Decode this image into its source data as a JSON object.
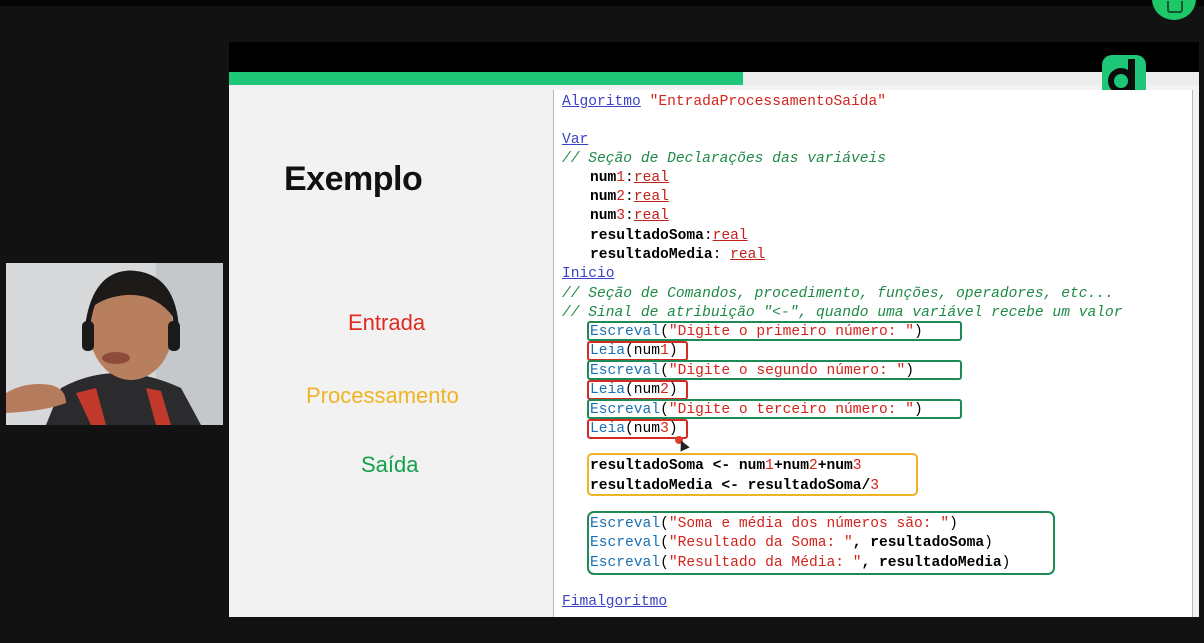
{
  "slide": {
    "progress_fraction": 0.53,
    "title": "Exemplo",
    "labels": {
      "entrada": "Entrada",
      "processamento": "Processamento",
      "saida": "Saída"
    },
    "colors": {
      "accent_green": "#1ec778",
      "entrada": "#e02b20",
      "processamento": "#f0b323",
      "saida": "#14a04b"
    }
  },
  "code": {
    "algoritmo_kw": "Algoritmo",
    "algoritmo_name": " \"EntradaProcessamentoSaída\"",
    "var_kw": "Var",
    "comment_decl": "// Seção de Declarações das variáveis",
    "decl": [
      {
        "name": "num",
        "digit": "1",
        "sep": ":",
        "type": "real"
      },
      {
        "name": "num",
        "digit": "2",
        "sep": ":",
        "type": "real"
      },
      {
        "name": "num",
        "digit": "3",
        "sep": ":",
        "type": "real"
      },
      {
        "name": "resultadoSoma",
        "digit": "",
        "sep": ":",
        "type": "real"
      },
      {
        "name": "resultadoMedia",
        "digit": "",
        "sep": ": ",
        "type": "real"
      }
    ],
    "inicio_kw": "Inicio",
    "comment_cmd": "// Seção de Comandos, procedimento, funções, operadores, etc...",
    "comment_attr": "// Sinal de atribuição \"<-\", quando uma variável recebe um valor",
    "escreval": "Escreval",
    "leia": "Leia",
    "msg1": "\"Digite o primeiro número: \"",
    "msg2": "\"Digite o segundo número: \"",
    "msg3": "\"Digite o terceiro número: \"",
    "num": "num",
    "d1": "1",
    "d2": "2",
    "d3": "3",
    "soma_lhs": "resultadoSoma <- ",
    "plus": "+",
    "media_expr": "resultadoMedia <- resultadoSoma/",
    "msg_out1": "\"Soma e média dos números são: \"",
    "msg_out2": "\"Resultado da Soma: \"",
    "var_out2": ", resultadoSoma",
    "msg_out3": "\"Resultado da Média: \"",
    "var_out3": ", resultadoMedia",
    "fim_kw": "Fimalgoritmo"
  }
}
